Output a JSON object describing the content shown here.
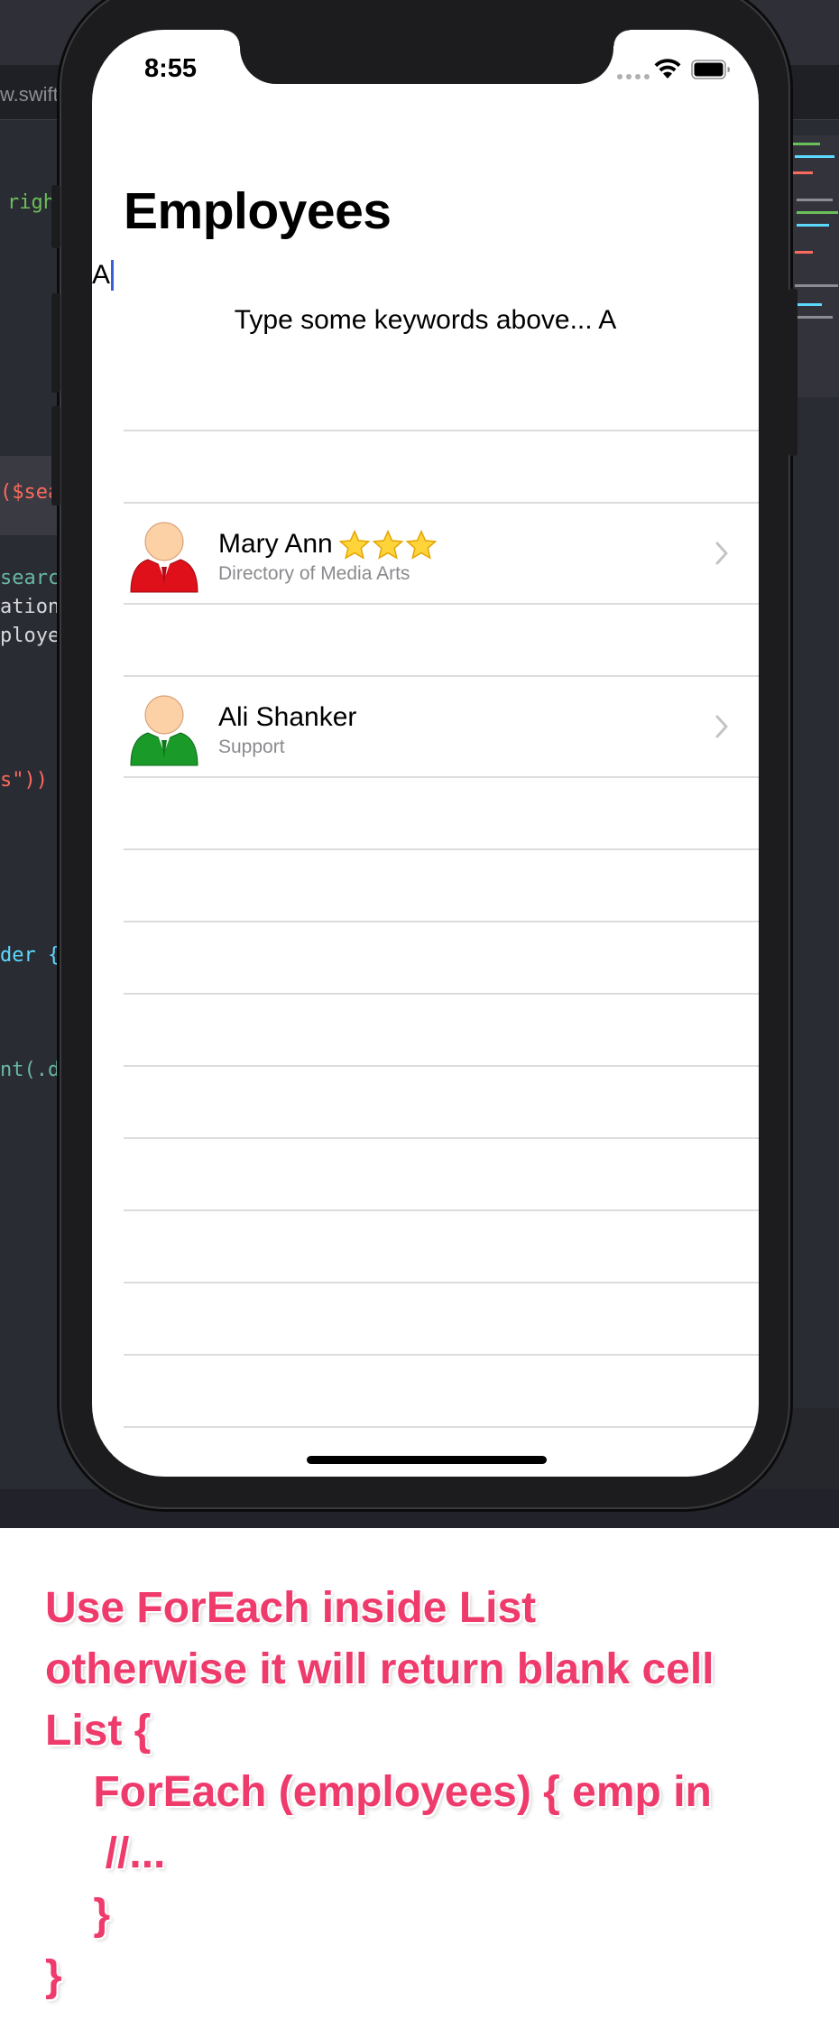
{
  "xcode": {
    "tab_label": "w.swift",
    "code": {
      "line_righ": "righ",
      "line_sea": "($sea",
      "line_search": "search",
      "line_ation": "ation",
      "line_ploye": "ploye",
      "line_s": "s\"))",
      "line_der": "der {",
      "line_nt": "nt(.d"
    }
  },
  "status_bar": {
    "time": "8:55"
  },
  "screen": {
    "title": "Employees",
    "search_value": "A",
    "hint": "Type some keywords above... A"
  },
  "employees": [
    {
      "name": "Mary Ann",
      "department": "Directory of Media Arts",
      "stars": 3,
      "avatar_color": "#e0101a"
    },
    {
      "name": "Ali Shanker",
      "department": "Support",
      "stars": 0,
      "avatar_color": "#1a9a28"
    }
  ],
  "caption": {
    "lines": [
      "Use ForEach inside List",
      "otherwise it will return blank cell",
      "List {",
      "    ForEach (employees) { emp in",
      "     //...",
      "    }",
      "}"
    ],
    "color": "#ef3a6c"
  }
}
